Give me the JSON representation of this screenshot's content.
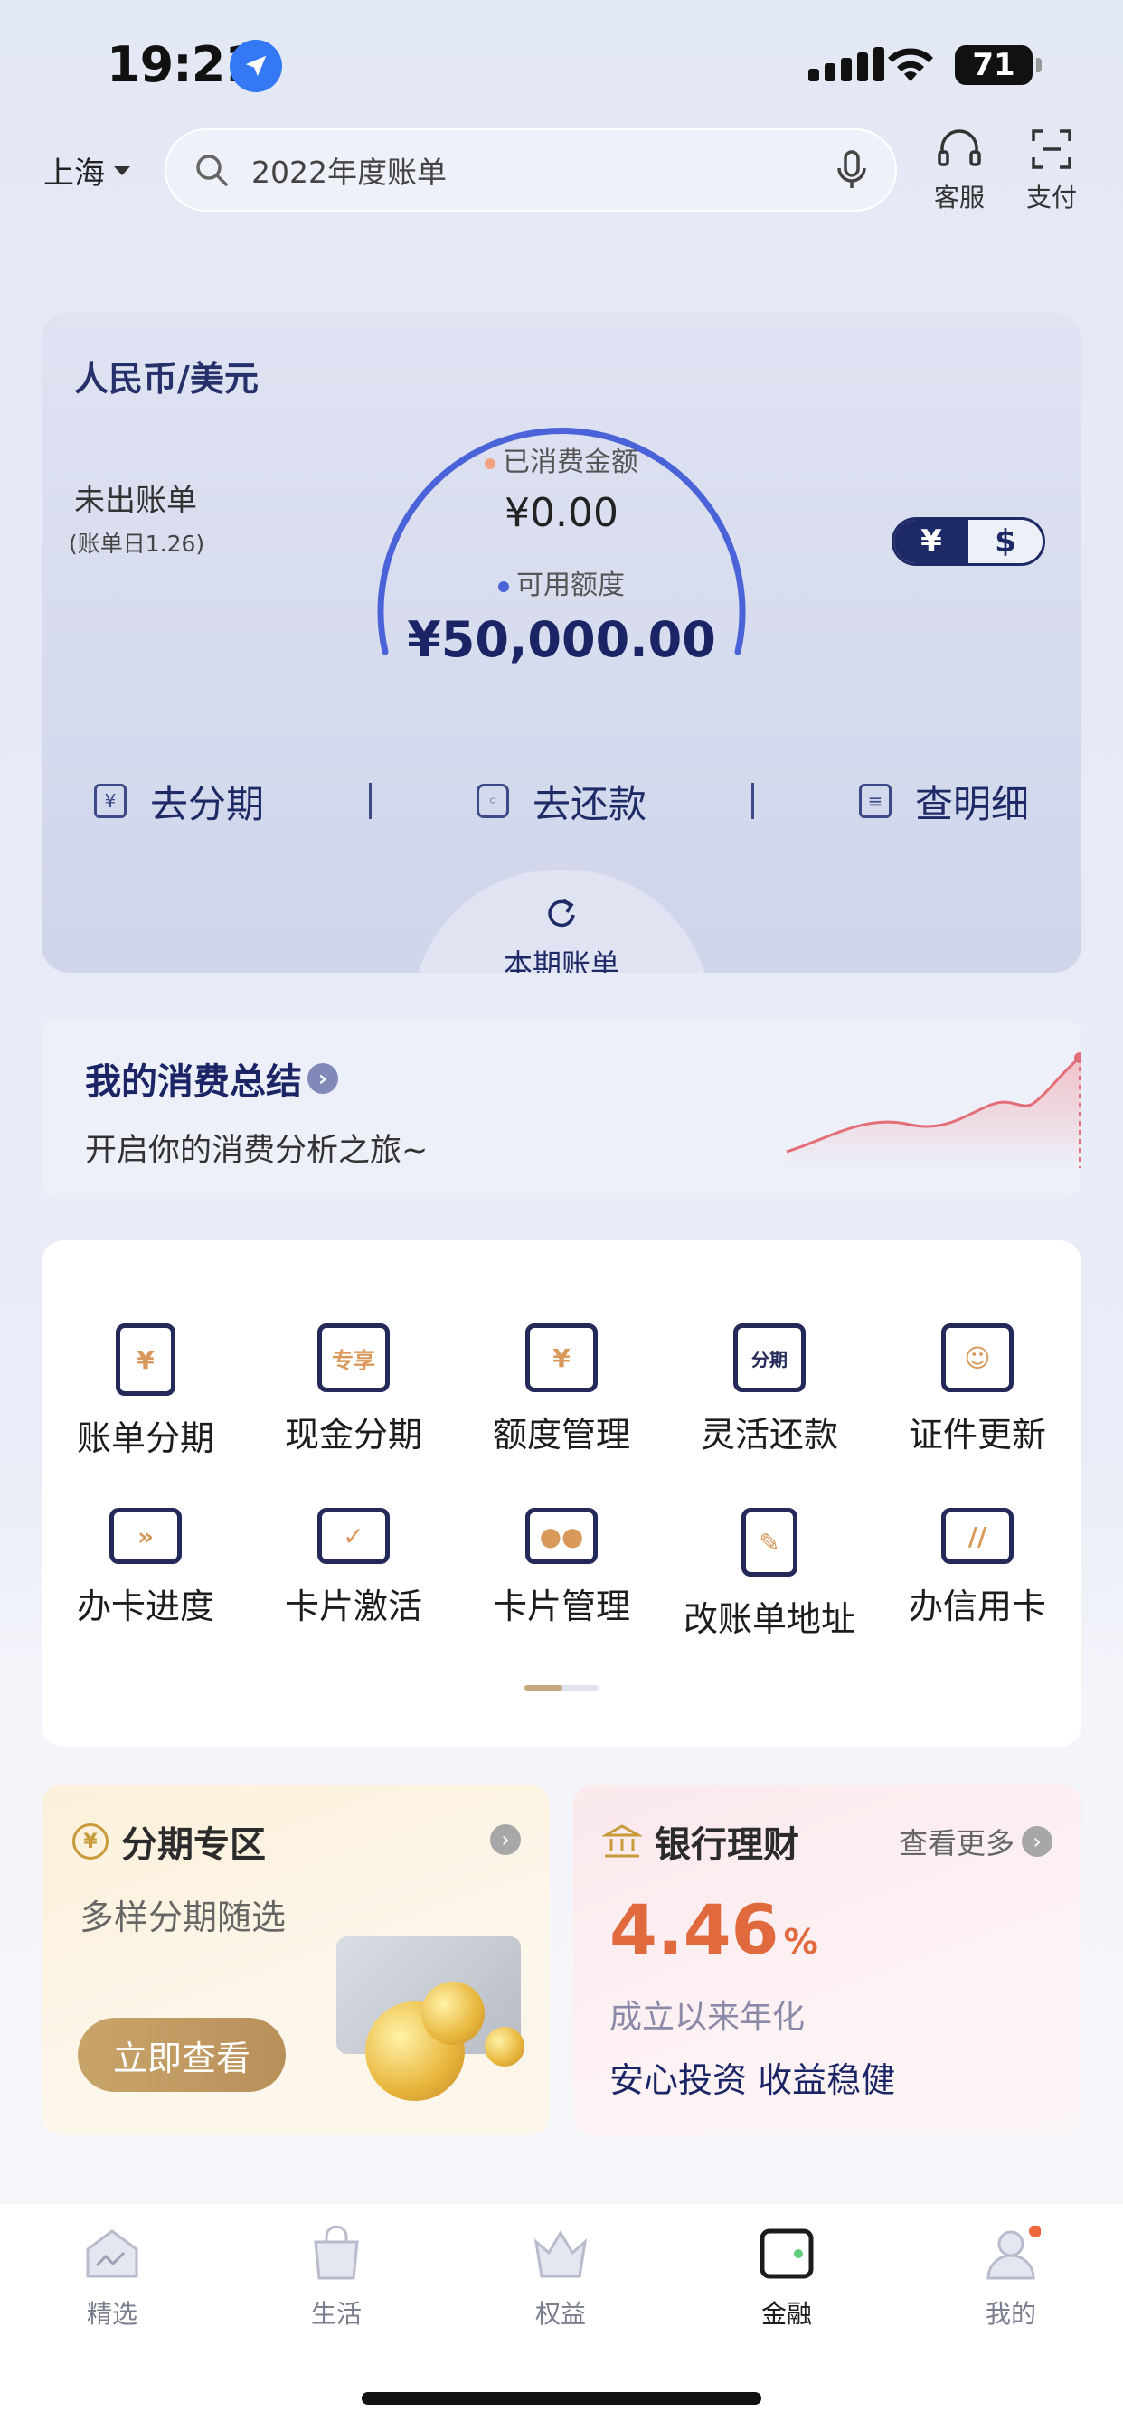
{
  "status_bar": {
    "time": "19:21",
    "battery": "71"
  },
  "header": {
    "city": "上海",
    "search_placeholder": "2022年度账单",
    "service_label": "客服",
    "pay_label": "支付"
  },
  "credit": {
    "title": "人民币/美元",
    "bill_status": "未出账单",
    "bill_date": "(账单日1.26)",
    "spent_label": "已消费金额",
    "spent_value": "¥0.00",
    "available_label": "可用额度",
    "available_value": "¥50,000.00",
    "currency_rmb": "¥",
    "currency_usd": "$",
    "actions": {
      "installment": "去分期",
      "repay": "去还款",
      "details": "查明细"
    },
    "current_bill": "本期账单"
  },
  "summary": {
    "title": "我的消费总结",
    "subtitle": "开启你的消费分析之旅~"
  },
  "grid": {
    "items": [
      {
        "label": "账单分期",
        "icon_text": "¥"
      },
      {
        "label": "现金分期",
        "icon_text": "专享"
      },
      {
        "label": "额度管理",
        "icon_text": "¥"
      },
      {
        "label": "灵活还款",
        "icon_text": "分期"
      },
      {
        "label": "证件更新",
        "icon_text": ""
      },
      {
        "label": "办卡进度",
        "icon_text": ""
      },
      {
        "label": "卡片激活",
        "icon_text": ""
      },
      {
        "label": "卡片管理",
        "icon_text": ""
      },
      {
        "label": "改账单地址",
        "icon_text": ""
      },
      {
        "label": "办信用卡",
        "icon_text": ""
      }
    ]
  },
  "promo_installment": {
    "title": "分期专区",
    "subtitle": "多样分期随选",
    "button": "立即查看"
  },
  "promo_wealth": {
    "title": "银行理财",
    "more": "查看更多",
    "rate": "4.46",
    "rate_unit": "%",
    "rate_desc": "成立以来年化",
    "tagline": "安心投资 收益稳健"
  },
  "tabbar": {
    "tabs": [
      {
        "label": "精选"
      },
      {
        "label": "生活"
      },
      {
        "label": "权益"
      },
      {
        "label": "金融"
      },
      {
        "label": "我的"
      }
    ],
    "active": "金融"
  }
}
